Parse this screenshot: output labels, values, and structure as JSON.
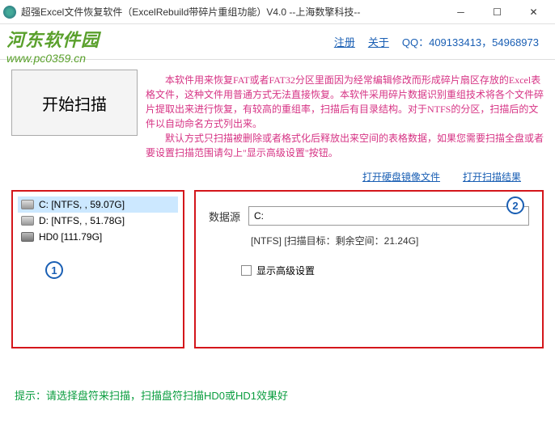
{
  "titlebar": {
    "text": "超强Excel文件恢复软件（ExcelRebuild带碎片重组功能）V4.0  --上海数擎科技--"
  },
  "watermark": {
    "title": "河东软件园",
    "url": "www.pc0359.cn"
  },
  "header": {
    "register": "注册",
    "about": "关于",
    "qq": "QQ：409133413，54968973"
  },
  "start_button": "开始扫描",
  "description": {
    "p1": "本软件用来恢复FAT或者FAT32分区里面因为经常编辑修改而形成碎片扇区存放的Excel表格文件，这种文件用普通方式无法直接恢复。本软件采用碎片数据识别重组技术将各个文件碎片提取出来进行恢复，有较高的重组率，扫描后有目录结构。对于NTFS的分区，扫描后的文件以自动命名方式列出来。",
    "p2": "默认方式只扫描被删除或者格式化后释放出来空间的表格数据，如果您需要扫描全盘或者要设置扫描范围请勾上\"显示高级设置\"按钮。"
  },
  "action_links": {
    "open_image": "打开硬盘镜像文件",
    "open_result": "打开扫描结果"
  },
  "drives": [
    {
      "label": "C:  [NTFS, , 59.07G]",
      "selected": true,
      "type": "drive"
    },
    {
      "label": "D:  [NTFS, , 51.78G]",
      "selected": false,
      "type": "drive"
    },
    {
      "label": "HD0  [111.79G]",
      "selected": false,
      "type": "hd"
    }
  ],
  "source": {
    "label": "数据源",
    "value": "C:",
    "info": "[NTFS]  [扫描目标：剩余空间：21.24G]",
    "checkbox_label": "显示高级设置"
  },
  "tip": "提示：请选择盘符来扫描，扫描盘符扫描HD0或HD1效果好",
  "badges": {
    "one": "1",
    "two": "2"
  }
}
